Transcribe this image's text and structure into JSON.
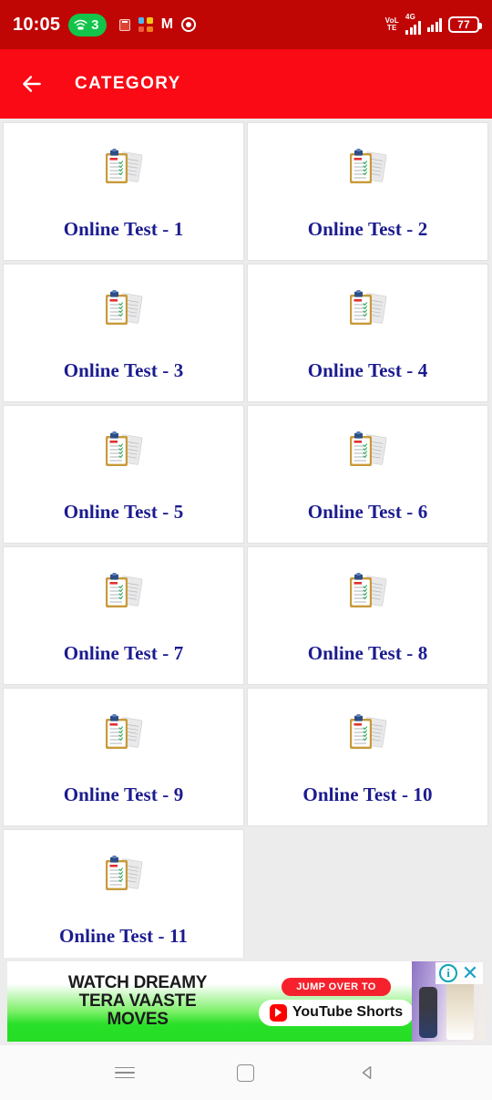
{
  "status_bar": {
    "time": "10:05",
    "hotspot_badge": "3",
    "hotspot_icon": "wifi-tether-icon",
    "app_icons": [
      "calendar-icon",
      "slack-icon",
      "gmail-icon",
      "chrome-icon"
    ],
    "volte_line1": "VoL",
    "volte_line2": "TE",
    "network_type": "4G",
    "battery_percent": "77",
    "background_color": "#c00505"
  },
  "app_bar": {
    "title": "CATEGORY",
    "back_label": "Back",
    "background_color": "#fa0a14",
    "text_color": "#ffffff"
  },
  "grid": {
    "icon_caption": "",
    "label_color": "#1b1b8f",
    "cards": [
      {
        "label": "Online Test - 1",
        "icon": "clipboard-test-icon"
      },
      {
        "label": "Online Test - 2",
        "icon": "clipboard-test-icon"
      },
      {
        "label": "Online Test - 3",
        "icon": "clipboard-test-icon"
      },
      {
        "label": "Online Test - 4",
        "icon": "clipboard-test-icon"
      },
      {
        "label": "Online Test - 5",
        "icon": "clipboard-test-icon"
      },
      {
        "label": "Online Test - 6",
        "icon": "clipboard-test-icon"
      },
      {
        "label": "Online Test - 7",
        "icon": "clipboard-test-icon"
      },
      {
        "label": "Online Test - 8",
        "icon": "clipboard-test-icon"
      },
      {
        "label": "Online Test - 9",
        "icon": "clipboard-test-icon"
      },
      {
        "label": "Online Test - 10",
        "icon": "clipboard-test-icon"
      },
      {
        "label": "Online Test - 11",
        "icon": "clipboard-test-icon"
      }
    ]
  },
  "ad": {
    "headline_line1": "WATCH DREAMY",
    "headline_line2": "TERA VAASTE",
    "headline_line3": "MOVES",
    "cta_pill": "JUMP OVER TO",
    "cta_brand": "YouTube Shorts",
    "info_label": "i",
    "close_label": "✕"
  },
  "nav_bar": {
    "recents_label": "Recents",
    "home_label": "Home",
    "back_label": "Back"
  }
}
